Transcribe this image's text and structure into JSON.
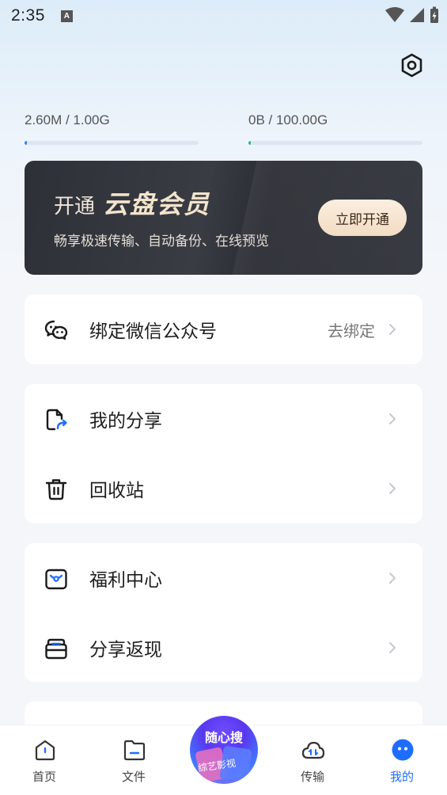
{
  "status_bar": {
    "time": "2:35",
    "indicator": "A"
  },
  "storage": [
    {
      "label": "2.60M / 1.00G",
      "fill": 0.01,
      "color": "#2f7bff"
    },
    {
      "label": "0B / 100.00G",
      "fill": 0.005,
      "color": "#22c07a"
    }
  ],
  "vip": {
    "prefix": "开通",
    "name": "云盘会员",
    "desc": "畅享极速传输、自动备份、在线预览",
    "button": "立即开通"
  },
  "wechat": {
    "label": "绑定微信公众号",
    "action": "去绑定"
  },
  "menu_group1": [
    {
      "label": "我的分享",
      "icon": "share-file-icon"
    },
    {
      "label": "回收站",
      "icon": "trash-icon"
    }
  ],
  "menu_group2": [
    {
      "label": "福利中心",
      "icon": "gift-icon"
    },
    {
      "label": "分享返现",
      "icon": "cashback-icon"
    }
  ],
  "tabs": [
    {
      "label": "首页",
      "icon": "home-icon"
    },
    {
      "label": "文件",
      "icon": "folder-icon"
    },
    {
      "label": "传输",
      "icon": "cloud-transfer-icon"
    },
    {
      "label": "我的",
      "icon": "profile-icon",
      "active": true
    }
  ],
  "center": {
    "title": "随心搜",
    "subtitle": "综艺影视"
  },
  "colors": {
    "accent": "#1f6dff",
    "banner_bg": "#2e3038",
    "banner_button": "#f6e2cb"
  }
}
